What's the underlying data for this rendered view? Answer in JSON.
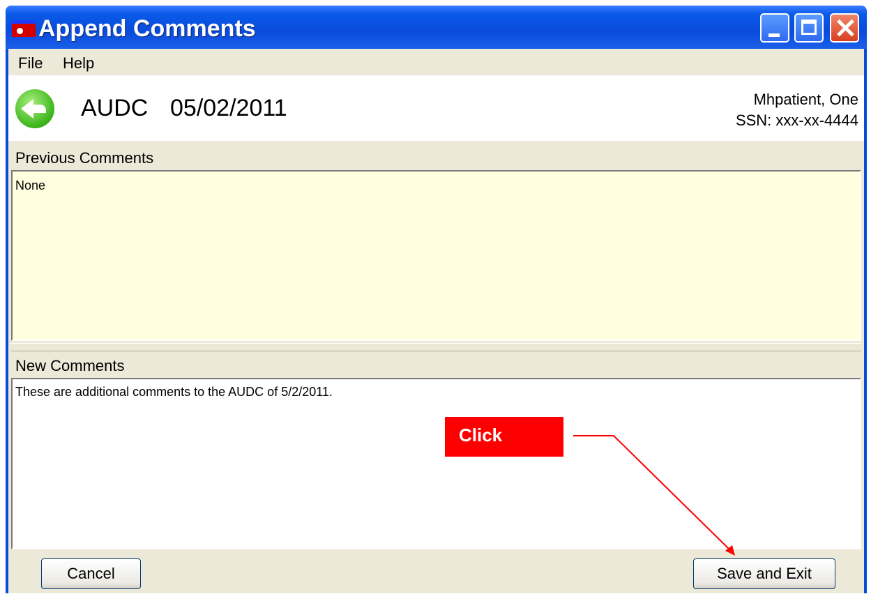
{
  "window": {
    "title": "Append Comments"
  },
  "menu": {
    "file": "File",
    "help": "Help"
  },
  "header": {
    "doc_type": "AUDC",
    "doc_date": "05/02/2011",
    "patient_name": "Mhpatient, One",
    "patient_ssn": "SSN: xxx-xx-4444"
  },
  "previous": {
    "label": "Previous Comments",
    "text": "None"
  },
  "new": {
    "label": "New Comments",
    "text": "These are additional comments to the AUDC of 5/2/2011."
  },
  "buttons": {
    "cancel": "Cancel",
    "save_exit": "Save and Exit"
  },
  "annotation": {
    "callout": "Click",
    "color": "#ff0000"
  }
}
